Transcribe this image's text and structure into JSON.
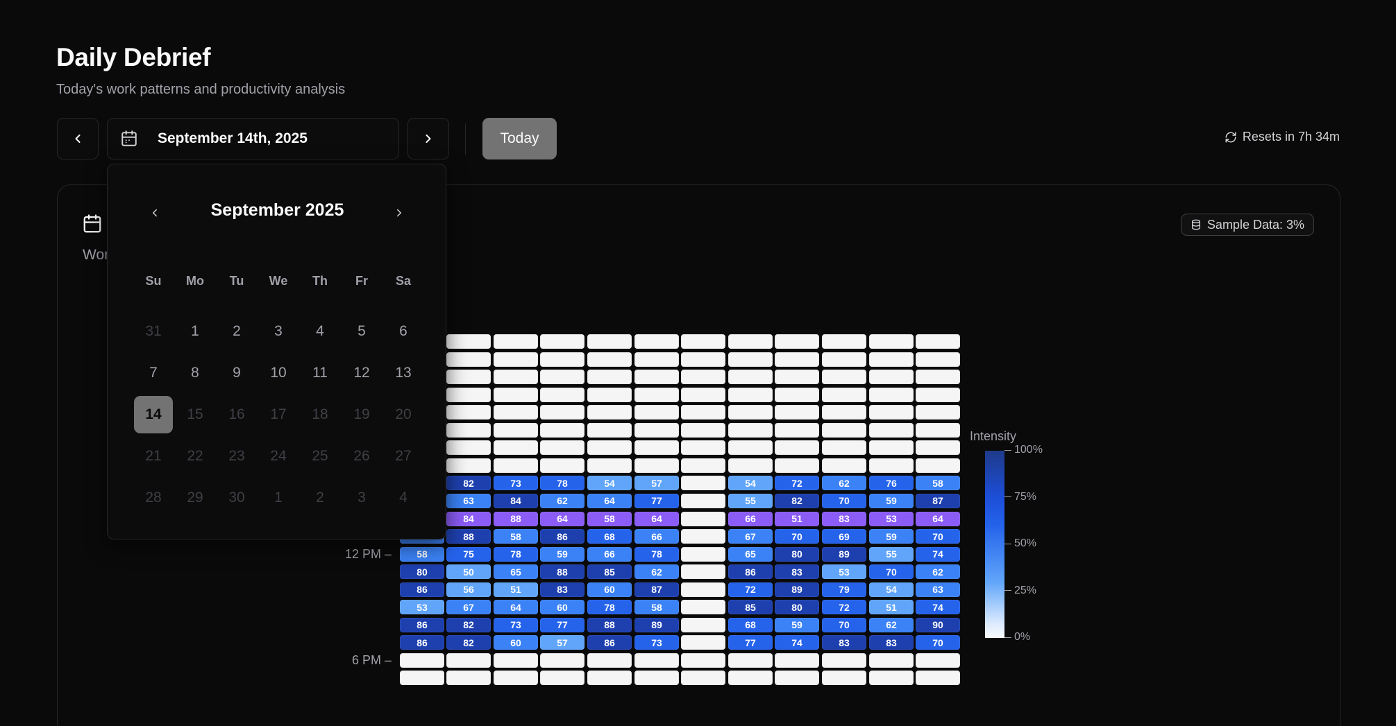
{
  "header": {
    "title": "Daily Debrief",
    "subtitle": "Today's work patterns and productivity analysis"
  },
  "toolbar": {
    "date_label": "September 14th, 2025",
    "today_label": "Today",
    "resets_label": "Resets in 7h 34m"
  },
  "card": {
    "label": "Wor",
    "sample_badge": "Sample Data: 3%"
  },
  "calendar": {
    "month_label": "September 2025",
    "weekdays": [
      "Su",
      "Mo",
      "Tu",
      "We",
      "Th",
      "Fr",
      "Sa"
    ],
    "selected_day": "14",
    "weeks": [
      [
        "31",
        "1",
        "2",
        "3",
        "4",
        "5",
        "6"
      ],
      [
        "7",
        "8",
        "9",
        "10",
        "11",
        "12",
        "13"
      ],
      [
        "14",
        "15",
        "16",
        "17",
        "18",
        "19",
        "20"
      ],
      [
        "21",
        "22",
        "23",
        "24",
        "25",
        "26",
        "27"
      ],
      [
        "28",
        "29",
        "30",
        "1",
        "2",
        "3",
        "4"
      ]
    ],
    "states": [
      [
        "outside",
        "normal",
        "normal",
        "normal",
        "normal",
        "normal",
        "normal"
      ],
      [
        "normal",
        "normal",
        "normal",
        "normal",
        "normal",
        "normal",
        "normal"
      ],
      [
        "selected",
        "disabled",
        "disabled",
        "disabled",
        "disabled",
        "disabled",
        "disabled"
      ],
      [
        "disabled",
        "disabled",
        "disabled",
        "disabled",
        "disabled",
        "disabled",
        "disabled"
      ],
      [
        "disabled",
        "disabled",
        "disabled",
        "outside",
        "outside",
        "outside",
        "outside"
      ]
    ]
  },
  "heatmap": {
    "hour_labels": [
      "12 PM",
      "6 PM"
    ],
    "legend": {
      "title": "Intensity",
      "ticks": [
        "100%",
        "75%",
        "50%",
        "25%",
        "0%"
      ]
    },
    "colors": {
      "empty": "#f5f5f5",
      "purple": "#8b5cf6",
      "light": "#60a5fa",
      "mid": "#3b82f6",
      "strong": "#2563eb",
      "deep": "#1e40af"
    },
    "active_rows": [
      [
        "",
        "82",
        "73",
        "78",
        "54",
        "57",
        null,
        "54",
        "72",
        "62",
        "76",
        "58"
      ],
      [
        "",
        "63",
        "84",
        "62",
        "64",
        "77",
        null,
        "55",
        "82",
        "70",
        "59",
        "87"
      ],
      [
        "",
        "84",
        "88",
        "64",
        "58",
        "64",
        null,
        "66",
        "51",
        "83",
        "53",
        "64"
      ],
      [
        "",
        "88",
        "58",
        "86",
        "68",
        "66",
        null,
        "67",
        "70",
        "69",
        "59",
        "70"
      ],
      [
        "58",
        "75",
        "78",
        "59",
        "66",
        "78",
        null,
        "65",
        "80",
        "89",
        "55",
        "74"
      ],
      [
        "80",
        "50",
        "65",
        "88",
        "85",
        "62",
        null,
        "86",
        "83",
        "53",
        "70",
        "62"
      ],
      [
        "86",
        "56",
        "51",
        "83",
        "60",
        "87",
        null,
        "72",
        "89",
        "79",
        "54",
        "63"
      ],
      [
        "53",
        "67",
        "64",
        "60",
        "78",
        "58",
        null,
        "85",
        "80",
        "72",
        "51",
        "74"
      ],
      [
        "86",
        "82",
        "73",
        "77",
        "88",
        "89",
        null,
        "68",
        "59",
        "70",
        "62",
        "90"
      ],
      [
        "86",
        "82",
        "60",
        "57",
        "86",
        "73",
        null,
        "77",
        "74",
        "83",
        "83",
        "70"
      ]
    ],
    "purple_row_index": 2
  }
}
